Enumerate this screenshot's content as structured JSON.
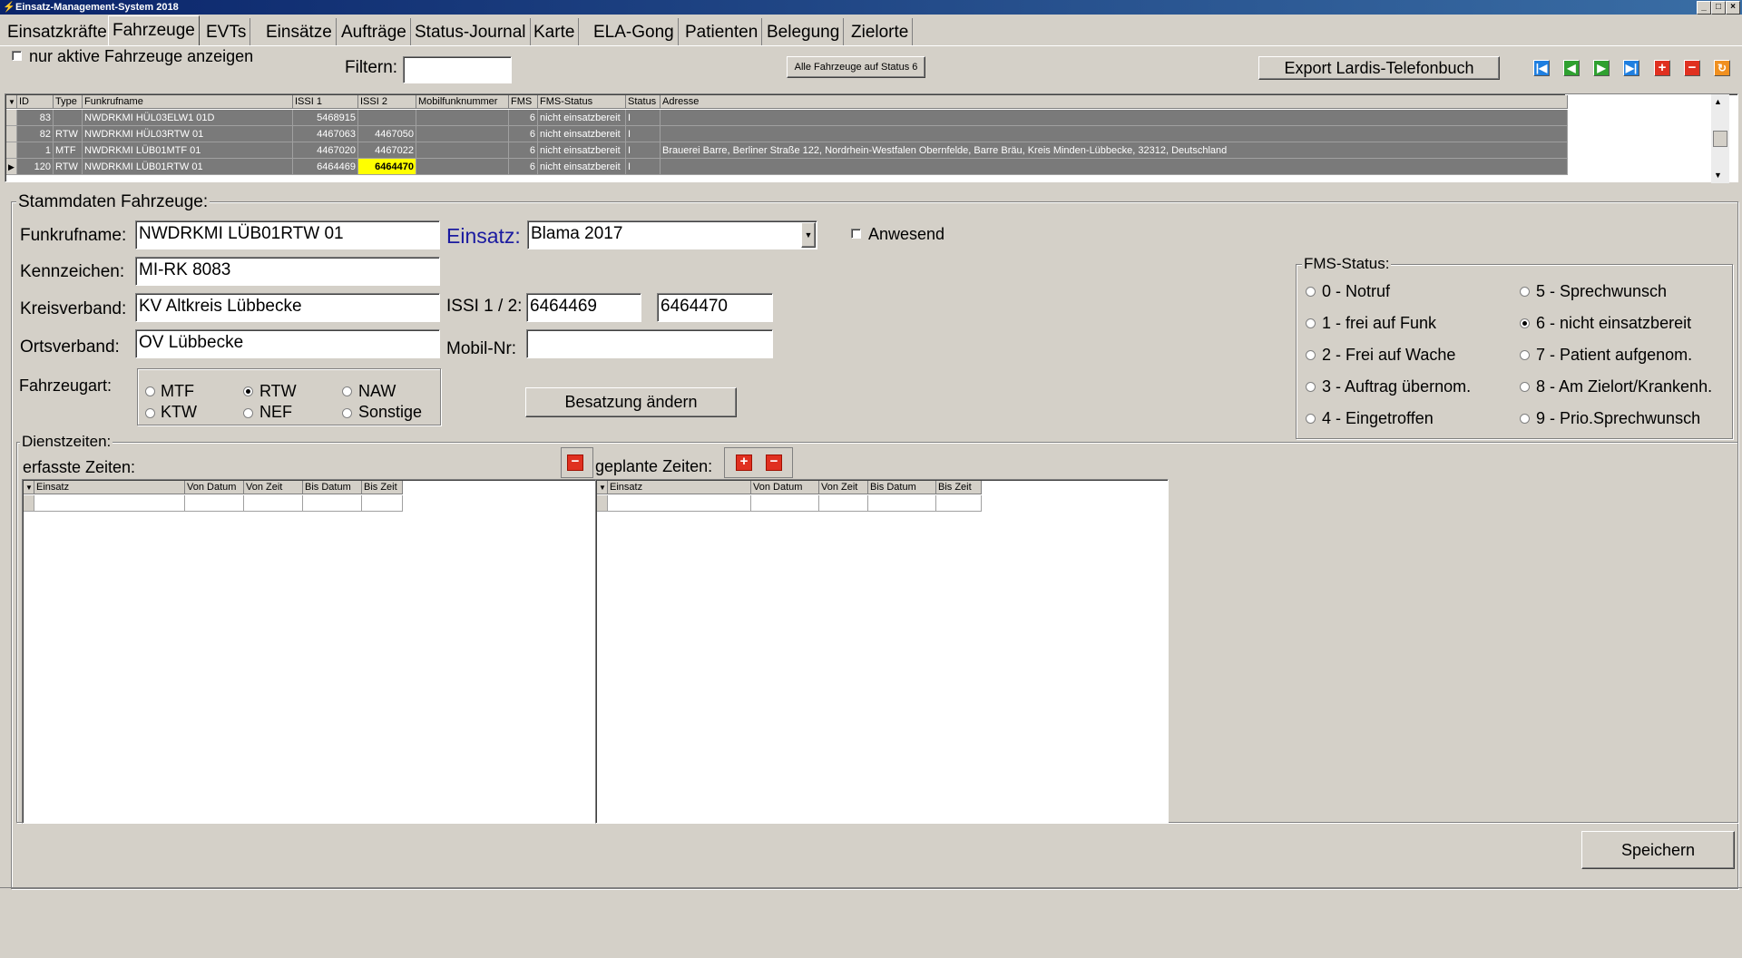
{
  "window": {
    "title": "Einsatz-Management-System 2018",
    "min": "_",
    "max": "□",
    "close": "×"
  },
  "tabs": [
    "Einsatzkräfte",
    "Fahrzeuge",
    "EVTs",
    "Einsätze",
    "Aufträge",
    "Status-Journal",
    "Karte",
    "ELA-Gong",
    "Patienten",
    "Belegung",
    "Zielorte"
  ],
  "toolbar": {
    "only_active_label": "nur aktive Fahrzeuge anzeigen",
    "filter_label": "Filtern:",
    "filter_value": "",
    "all_status6_button": "Alle Fahrzeuge auf Status 6",
    "export_button": "Export Lardis-Telefonbuch"
  },
  "vehicle_grid": {
    "columns": [
      "ID",
      "Type",
      "Funkrufname",
      "ISSI 1",
      "ISSI 2",
      "Mobilfunknummer",
      "FMS",
      "FMS-Status",
      "Status",
      "Adresse"
    ],
    "rows": [
      [
        "83",
        "",
        "NWDRKMI HÜL03ELW1    01D",
        "5468915",
        "",
        "",
        "6",
        "nicht einsatzbereit",
        "I",
        ""
      ],
      [
        "82",
        "RTW",
        "NWDRKMI HÜL03RTW    01",
        "4467063",
        "4467050",
        "",
        "6",
        "nicht einsatzbereit",
        "I",
        ""
      ],
      [
        "1",
        "MTF",
        "NWDRKMI LÜB01MTF    01",
        "4467020",
        "4467022",
        "",
        "6",
        "nicht einsatzbereit",
        "I",
        "Brauerei Barre,  Berliner Straße  122,  Nordrhein-Westfalen  Obernfelde,  Barre Bräu,  Kreis Minden-Lübbecke,  32312,  Deutschland"
      ],
      [
        "120",
        "RTW",
        "NWDRKMI LÜB01RTW    01",
        "6464469",
        "6464470",
        "",
        "6",
        "nicht einsatzbereit",
        "I",
        ""
      ]
    ],
    "selected_row": 3
  },
  "stammdaten": {
    "group_label": "Stammdaten Fahrzeuge:",
    "funkrufname_label": "Funkrufname:",
    "funkrufname_value": "NWDRKMI LÜB01RTW     01",
    "kennzeichen_label": "Kennzeichen:",
    "kennzeichen_value": "MI-RK 8083",
    "kreisverband_label": "Kreisverband:",
    "kreisverband_value": "KV Altkreis Lübbecke",
    "ortsverband_label": "Ortsverband:",
    "ortsverband_value": "OV Lübbecke",
    "einsatz_label": "Einsatz:",
    "einsatz_value": "Blama 2017",
    "anwesend_label": "Anwesend",
    "issi_label": "ISSI 1 / 2:",
    "issi1_value": "6464469",
    "issi2_value": "6464470",
    "mobil_label": "Mobil-Nr:",
    "mobil_value": "",
    "fahrzeugart_label": "Fahrzeugart:",
    "fahrzeugart_options": [
      "MTF",
      "RTW",
      "NAW",
      "KTW",
      "NEF",
      "Sonstige"
    ],
    "fahrzeugart_selected": "RTW",
    "besatzung_button": "Besatzung ändern"
  },
  "fms": {
    "group_label": "FMS-Status:",
    "options": [
      "0 - Notruf",
      "1 - frei auf Funk",
      "2 - Frei auf Wache",
      "3 - Auftrag übernom.",
      "4 - Eingetroffen",
      "5 - Sprechwunsch",
      "6 - nicht einsatzbereit",
      "7 - Patient aufgenom.",
      "8 - Am Zielort/Krankenh.",
      "9 - Prio.Sprechwunsch"
    ],
    "selected": "6 - nicht einsatzbereit"
  },
  "dienstzeiten": {
    "group_label": "Dienstzeiten:",
    "erfasst_label": "erfasste Zeiten:",
    "geplant_label": "geplante Zeiten:",
    "erfasst_columns": [
      "Einsatz",
      "Von Datum",
      "Von Zeit",
      "Bis Datum",
      "Bis Zeit"
    ],
    "geplant_columns": [
      "Einsatz",
      "Von Datum",
      "Von Zeit",
      "Bis Datum",
      "Bis Zeit"
    ]
  },
  "save_button": "Speichern",
  "icons": {
    "nav": [
      "first-icon",
      "prev-icon",
      "next-icon",
      "last-icon",
      "add-icon",
      "delete-icon",
      "refresh-icon"
    ]
  }
}
